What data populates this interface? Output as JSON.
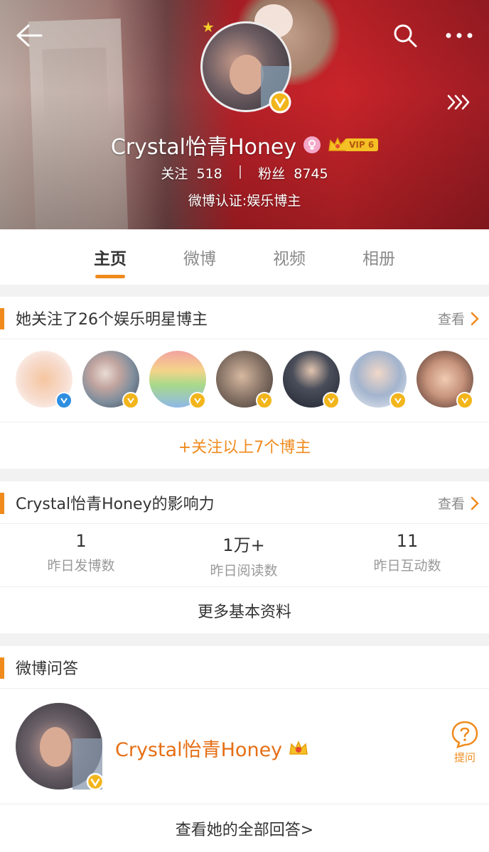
{
  "profile": {
    "name": "Crystal怡青Honey",
    "vip_level": "VIP 6",
    "following_label": "关注",
    "following_count": "518",
    "followers_label": "粉丝",
    "followers_count": "8745",
    "verification": "微博认证:娱乐博主",
    "separator": "|"
  },
  "tabs": [
    {
      "label": "主页",
      "active": true
    },
    {
      "label": "微博",
      "active": false
    },
    {
      "label": "视频",
      "active": false
    },
    {
      "label": "相册",
      "active": false
    }
  ],
  "followed_card": {
    "title": "她关注了26个娱乐明星博主",
    "see_label": "查看",
    "follow_all_label": "+关注以上7个博主",
    "avatars": [
      {
        "badge": "blue"
      },
      {
        "badge": "gold"
      },
      {
        "badge": "gold"
      },
      {
        "badge": "gold"
      },
      {
        "badge": "gold"
      },
      {
        "badge": "gold"
      },
      {
        "badge": "gold"
      }
    ]
  },
  "influence_card": {
    "title": "Crystal怡青Honey的影响力",
    "see_label": "查看",
    "metrics": [
      {
        "value": "1",
        "label": "昨日发博数"
      },
      {
        "value": "1万+",
        "label": "昨日阅读数"
      },
      {
        "value": "11",
        "label": "昨日互动数"
      }
    ],
    "more_label": "更多基本资料"
  },
  "qa_card": {
    "title": "微博问答",
    "name": "Crystal怡青Honey",
    "ask_label": "提问",
    "all_answers_label": "查看她的全部回答>"
  },
  "colors": {
    "accent": "#f08a1c",
    "verify_gold": "#f2b51b",
    "verify_blue": "#2e8ee0"
  }
}
